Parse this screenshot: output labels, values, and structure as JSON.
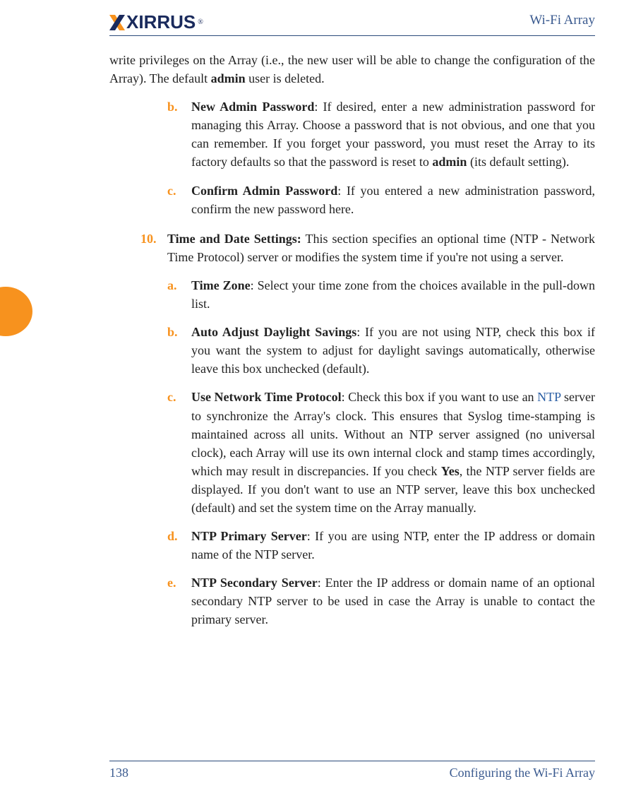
{
  "brand": {
    "name": "XIRRUS",
    "registered": "®"
  },
  "header": {
    "title": "Wi-Fi Array"
  },
  "footer": {
    "page": "138",
    "section": "Configuring the Wi-Fi Array"
  },
  "body": {
    "cont_text_pre": "write privileges on the Array (i.e., the new user will be able to change the configuration of the Array). The default ",
    "cont_bold": "admin",
    "cont_text_post": " user is deleted.",
    "item_b": {
      "marker": "b.",
      "term": "New Admin Password",
      "text_pre": ": If desired, enter a new administration password for managing this Array. Choose a password that is not obvious, and one that you can remember. If you forget your password, you must reset the Array to its factory defaults so that the password is reset to ",
      "bold_mid": "admin",
      "text_post": " (its default setting)."
    },
    "item_c": {
      "marker": "c.",
      "term": "Confirm Admin Password",
      "text": ": If you entered a new administration password, confirm the new password here."
    },
    "item_10": {
      "marker": "10.",
      "term": "Time and Date Settings:",
      "text": " This section specifies an optional time (NTP - Network Time Protocol) server or modifies the system time if you're not using a server."
    },
    "item_10a": {
      "marker": "a.",
      "term": "Time Zone",
      "text": ": Select your time zone from the choices available in the pull-down list."
    },
    "item_10b": {
      "marker": "b.",
      "term": "Auto Adjust Daylight Savings",
      "text": ": If you are not using NTP, check this box if you want the system to adjust for daylight savings automatically, otherwise leave this box unchecked (default)."
    },
    "item_10c": {
      "marker": "c.",
      "term": "Use Network Time Protocol",
      "text_pre": ": Check this box if you want to use an ",
      "link": "NTP",
      "text_mid": " server to synchronize the Array's clock. This ensures that Syslog time-stamping is maintained across all units. Without an NTP server assigned (no universal clock), each Array will use its own internal clock and stamp times accordingly, which may result in discrepancies. If you check ",
      "bold_mid": "Yes",
      "text_post": ", the NTP server fields are displayed. If you don't want to use an NTP server, leave this box unchecked (default) and set the system time on the Array manually."
    },
    "item_10d": {
      "marker": "d.",
      "term": "NTP Primary Server",
      "text": ": If you are using NTP, enter the IP address or domain name of the NTP server."
    },
    "item_10e": {
      "marker": "e.",
      "term": "NTP Secondary Server",
      "text": ": Enter the IP address or domain name of an optional secondary NTP server to be used in case the Array is unable to contact the primary server."
    }
  }
}
